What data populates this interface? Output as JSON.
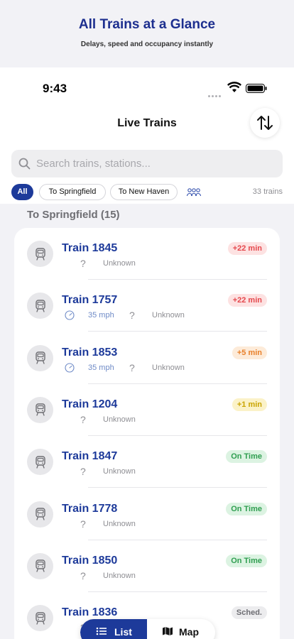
{
  "promo": {
    "title": "All Trains at a Glance",
    "subtitle": "Delays, speed and occupancy instantly"
  },
  "status_bar": {
    "time": "9:43"
  },
  "nav": {
    "title": "Live Trains",
    "sort_icon": "sort-arrows-icon"
  },
  "search": {
    "placeholder": "Search trains, stations..."
  },
  "filters": {
    "all": "All",
    "to_springfield": "To Springfield",
    "to_new_haven": "To New Haven",
    "occupancy_icon": "people-icon",
    "count": "33 trains"
  },
  "section": {
    "title": "To Springfield (15)"
  },
  "trains": [
    {
      "name": "Train 1845",
      "speed": "",
      "occupancy": "?",
      "status": "Unknown",
      "badge": "+22 min",
      "badge_color": "#e5484d",
      "badge_bg": "#fde2e2"
    },
    {
      "name": "Train 1757",
      "speed": "35 mph",
      "occupancy": "?",
      "status": "Unknown",
      "badge": "+22 min",
      "badge_color": "#e5484d",
      "badge_bg": "#fde2e2"
    },
    {
      "name": "Train 1853",
      "speed": "35 mph",
      "occupancy": "?",
      "status": "Unknown",
      "badge": "+5 min",
      "badge_color": "#e8802a",
      "badge_bg": "#fdebd9"
    },
    {
      "name": "Train 1204",
      "speed": "",
      "occupancy": "?",
      "status": "Unknown",
      "badge": "+1 min",
      "badge_color": "#c9a400",
      "badge_bg": "#fbf2c8"
    },
    {
      "name": "Train 1847",
      "speed": "",
      "occupancy": "?",
      "status": "Unknown",
      "badge": "On Time",
      "badge_color": "#2f9e50",
      "badge_bg": "#dcf3e2"
    },
    {
      "name": "Train 1778",
      "speed": "",
      "occupancy": "?",
      "status": "Unknown",
      "badge": "On Time",
      "badge_color": "#2f9e50",
      "badge_bg": "#dcf3e2"
    },
    {
      "name": "Train 1850",
      "speed": "",
      "occupancy": "?",
      "status": "Unknown",
      "badge": "On Time",
      "badge_color": "#2f9e50",
      "badge_bg": "#dcf3e2"
    },
    {
      "name": "Train 1836",
      "speed": "",
      "occupancy": "?",
      "status": "",
      "badge": "Sched.",
      "badge_color": "#6e6e73",
      "badge_bg": "#ececee"
    }
  ],
  "tabbar": {
    "list": "List",
    "map": "Map",
    "list_icon": "list-icon",
    "map_icon": "map-icon"
  }
}
